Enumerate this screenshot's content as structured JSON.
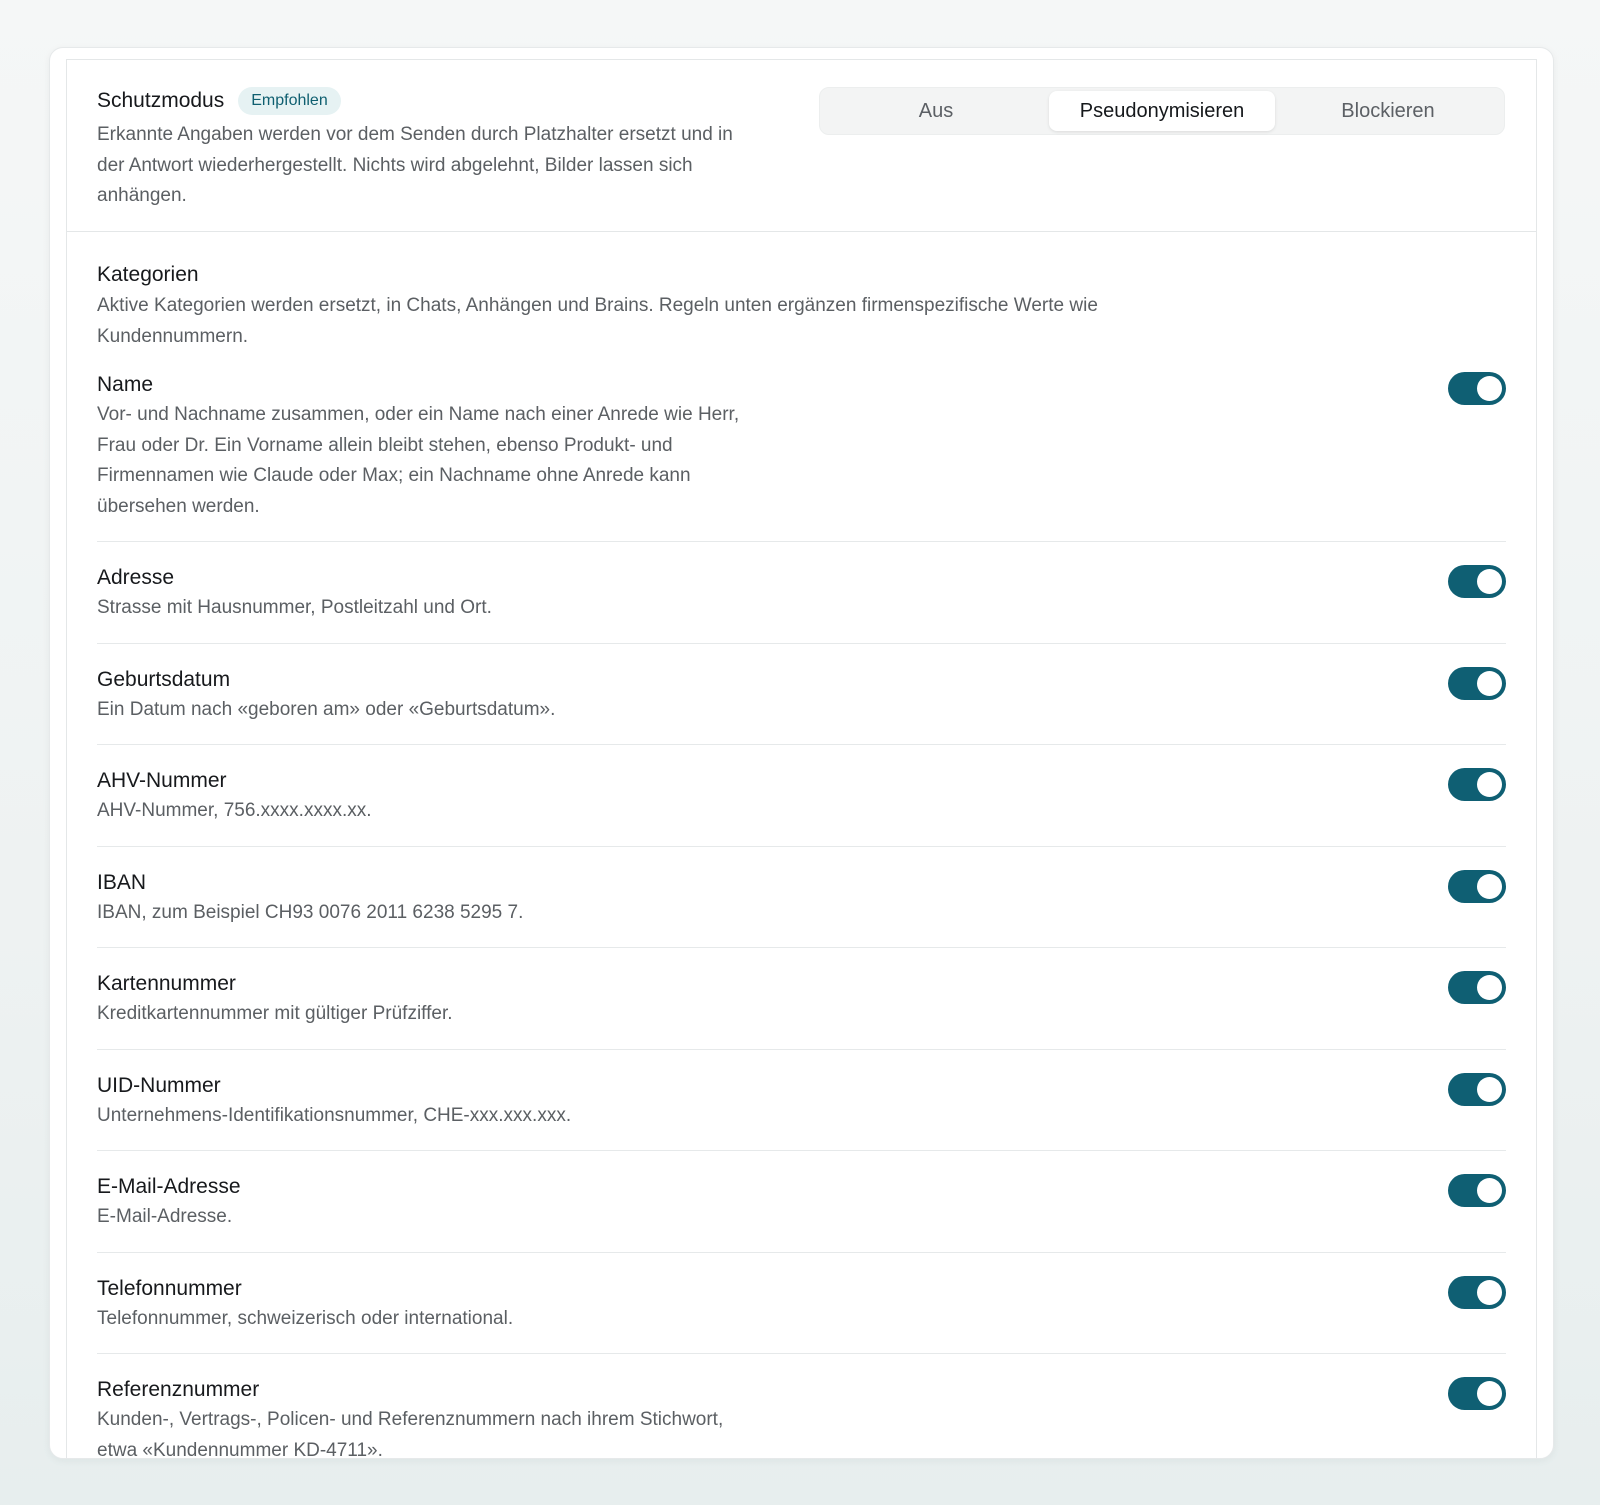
{
  "mode": {
    "title": "Schutzmodus",
    "badge": "Empfohlen",
    "description": "Erkannte Angaben werden vor dem Senden durch Platzhalter ersetzt und in der Antwort wiederhergestellt. Nichts wird abgelehnt, Bilder lassen sich anhängen.",
    "options": [
      {
        "label": "Aus",
        "selected": false
      },
      {
        "label": "Pseudonymisieren",
        "selected": true
      },
      {
        "label": "Blockieren",
        "selected": false
      }
    ]
  },
  "categories": {
    "title": "Kategorien",
    "description": "Aktive Kategorien werden ersetzt, in Chats, Anhängen und Brains. Regeln unten ergänzen firmenspezifische Werte wie Kundennummern.",
    "items": [
      {
        "title": "Name",
        "description": "Vor- und Nachname zusammen, oder ein Name nach einer Anrede wie Herr, Frau oder Dr. Ein Vorname allein bleibt stehen, ebenso Produkt- und Firmennamen wie Claude oder Max; ein Nachname ohne Anrede kann übersehen werden.",
        "enabled": true
      },
      {
        "title": "Adresse",
        "description": "Strasse mit Hausnummer, Postleitzahl und Ort.",
        "enabled": true
      },
      {
        "title": "Geburtsdatum",
        "description": "Ein Datum nach «geboren am» oder «Geburtsdatum».",
        "enabled": true
      },
      {
        "title": "AHV-Nummer",
        "description": "AHV-Nummer, 756.xxxx.xxxx.xx.",
        "enabled": true
      },
      {
        "title": "IBAN",
        "description": "IBAN, zum Beispiel CH93 0076 2011 6238 5295 7.",
        "enabled": true
      },
      {
        "title": "Kartennummer",
        "description": "Kreditkartennummer mit gültiger Prüfziffer.",
        "enabled": true
      },
      {
        "title": "UID-Nummer",
        "description": "Unternehmens-Identifikationsnummer, CHE-xxx.xxx.xxx.",
        "enabled": true
      },
      {
        "title": "E-Mail-Adresse",
        "description": "E-Mail-Adresse.",
        "enabled": true
      },
      {
        "title": "Telefonnummer",
        "description": "Telefonnummer, schweizerisch oder international.",
        "enabled": true
      },
      {
        "title": "Referenznummer",
        "description": "Kunden-, Vertrags-, Policen- und Referenznummern nach ihrem Stichwort, etwa «Kundennummer KD-4711».",
        "enabled": true
      }
    ]
  },
  "colors": {
    "accent": "#0f5f73",
    "badge_bg": "#e6f2f3",
    "badge_text": "#0f5f70"
  }
}
